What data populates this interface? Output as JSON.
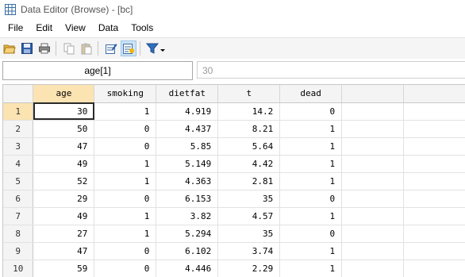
{
  "window": {
    "title": "Data Editor (Browse) - [bc]"
  },
  "menu": [
    "File",
    "Edit",
    "View",
    "Data",
    "Tools"
  ],
  "toolbar": {
    "icons": [
      "open-icon",
      "save-icon",
      "print-icon",
      "copy-icon",
      "paste-icon",
      "variables-manager-icon",
      "properties-icon",
      "filter-icon"
    ]
  },
  "cellbar": {
    "varname": "age[1]",
    "value": "30"
  },
  "grid": {
    "columns": [
      "age",
      "smoking",
      "dietfat",
      "t",
      "dead"
    ],
    "rows": [
      {
        "n": "1",
        "cells": [
          "30",
          "1",
          "4.919",
          "14.2",
          "0"
        ]
      },
      {
        "n": "2",
        "cells": [
          "50",
          "0",
          "4.437",
          "8.21",
          "1"
        ]
      },
      {
        "n": "3",
        "cells": [
          "47",
          "0",
          "5.85",
          "5.64",
          "1"
        ]
      },
      {
        "n": "4",
        "cells": [
          "49",
          "1",
          "5.149",
          "4.42",
          "1"
        ]
      },
      {
        "n": "5",
        "cells": [
          "52",
          "1",
          "4.363",
          "2.81",
          "1"
        ]
      },
      {
        "n": "6",
        "cells": [
          "29",
          "0",
          "6.153",
          "35",
          "0"
        ]
      },
      {
        "n": "7",
        "cells": [
          "49",
          "1",
          "3.82",
          "4.57",
          "1"
        ]
      },
      {
        "n": "8",
        "cells": [
          "27",
          "1",
          "5.294",
          "35",
          "0"
        ]
      },
      {
        "n": "9",
        "cells": [
          "47",
          "0",
          "6.102",
          "3.74",
          "1"
        ]
      },
      {
        "n": "10",
        "cells": [
          "59",
          "0",
          "4.446",
          "2.29",
          "1"
        ]
      }
    ]
  },
  "colors": {
    "active_header": "#fbe3b2",
    "header_bg": "#f4f4f4",
    "grid_line": "#e2e2e2"
  }
}
